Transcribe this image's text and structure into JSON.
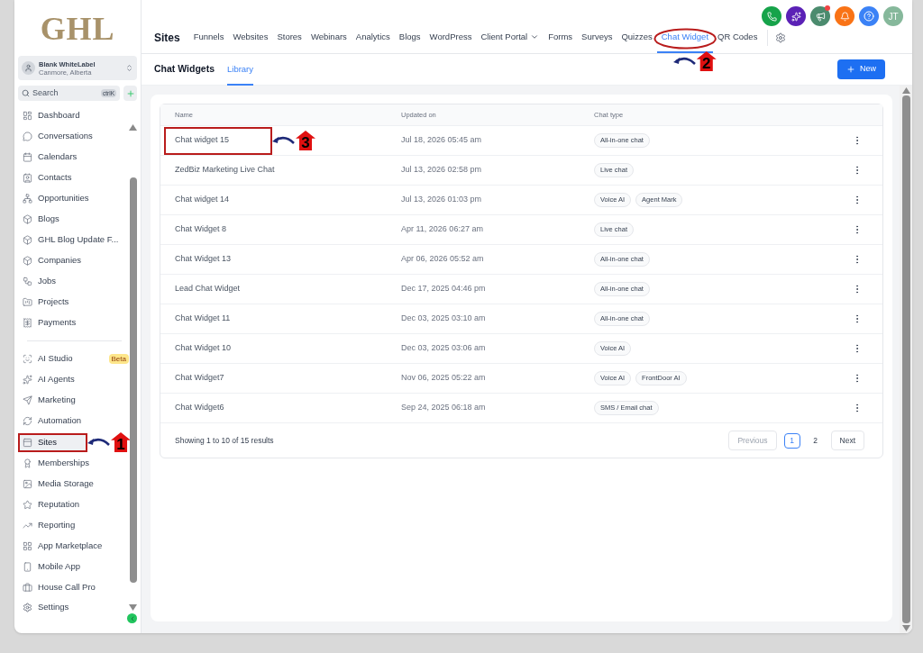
{
  "logo": "GHL",
  "account": {
    "name": "Blank WhiteLabel",
    "location": "Canmore, Alberta"
  },
  "search": {
    "placeholder": "Search",
    "shortcut": "ctrlK"
  },
  "sidebar": {
    "sections": [
      {
        "items": [
          {
            "label": "Dashboard",
            "selected": false
          },
          {
            "label": "Conversations",
            "selected": false
          },
          {
            "label": "Calendars",
            "selected": false
          },
          {
            "label": "Contacts",
            "selected": false
          },
          {
            "label": "Opportunities",
            "selected": false
          },
          {
            "label": "Blogs",
            "selected": false
          },
          {
            "label": "GHL Blog Update F...",
            "selected": false
          },
          {
            "label": "Companies",
            "selected": false
          },
          {
            "label": "Jobs",
            "selected": false
          },
          {
            "label": "Projects",
            "selected": false
          },
          {
            "label": "Payments",
            "selected": false
          }
        ]
      },
      {
        "items": [
          {
            "label": "AI Studio",
            "selected": false,
            "badge": "Beta"
          },
          {
            "label": "AI Agents",
            "selected": false
          },
          {
            "label": "Marketing",
            "selected": false
          },
          {
            "label": "Automation",
            "selected": false
          },
          {
            "label": "Sites",
            "selected": true,
            "annotation": "1"
          },
          {
            "label": "Memberships",
            "selected": false
          },
          {
            "label": "Media Storage",
            "selected": false
          },
          {
            "label": "Reputation",
            "selected": false
          },
          {
            "label": "Reporting",
            "selected": false
          },
          {
            "label": "App Marketplace",
            "selected": false
          },
          {
            "label": "Mobile App",
            "selected": false
          },
          {
            "label": "House Call Pro",
            "selected": false
          }
        ]
      }
    ],
    "footer": {
      "label": "Settings"
    }
  },
  "top_nav": {
    "title": "Sites",
    "tabs": [
      {
        "label": "Funnels",
        "selected": false
      },
      {
        "label": "Websites",
        "selected": false
      },
      {
        "label": "Stores",
        "selected": false
      },
      {
        "label": "Webinars",
        "selected": false
      },
      {
        "label": "Analytics",
        "selected": false
      },
      {
        "label": "Blogs",
        "selected": false
      },
      {
        "label": "WordPress",
        "selected": false
      },
      {
        "label": "Client Portal",
        "selected": false,
        "dropdown": true
      },
      {
        "label": "Forms",
        "selected": false
      },
      {
        "label": "Surveys",
        "selected": false
      },
      {
        "label": "Quizzes",
        "selected": false
      },
      {
        "label": "Chat Widget",
        "selected": true,
        "annotation": "2"
      },
      {
        "label": "QR Codes",
        "selected": false
      }
    ]
  },
  "header_icons": [
    {
      "kind": "phone",
      "color": "#16a34a"
    },
    {
      "kind": "sparkle",
      "color": "#5b21b6"
    },
    {
      "kind": "megaphone",
      "color": "#4b8b6e",
      "dot": true
    },
    {
      "kind": "bell",
      "color": "#f97316"
    },
    {
      "kind": "help",
      "color": "#3b82f6"
    },
    {
      "kind": "avatar",
      "color": "#86b89b",
      "text": "JT"
    }
  ],
  "sub_tabs": {
    "title": "Chat Widgets",
    "tabs": [
      {
        "label": "Library",
        "selected": true
      }
    ]
  },
  "new_button": "New",
  "table": {
    "columns": [
      "Name",
      "Updated on",
      "Chat type"
    ],
    "rows": [
      {
        "name": "Chat widget 15",
        "updated": "Jul 18, 2026 05:45 am",
        "types": [
          "All-in-one chat"
        ],
        "annotation": "3"
      },
      {
        "name": "ZedBiz Marketing Live Chat",
        "updated": "Jul 13, 2026 02:58 pm",
        "types": [
          "Live chat"
        ]
      },
      {
        "name": "Chat widget 14",
        "updated": "Jul 13, 2026 01:03 pm",
        "types": [
          "Voice AI",
          "Agent Mark"
        ]
      },
      {
        "name": "Chat Widget 8",
        "updated": "Apr 11, 2026 06:27 am",
        "types": [
          "Live chat"
        ]
      },
      {
        "name": "Chat Widget 13",
        "updated": "Apr 06, 2026 05:52 am",
        "types": [
          "All-in-one chat"
        ]
      },
      {
        "name": "Lead Chat Widget",
        "updated": "Dec 17, 2025 04:46 pm",
        "types": [
          "All-in-one chat"
        ]
      },
      {
        "name": "Chat Widget 11",
        "updated": "Dec 03, 2025 03:10 am",
        "types": [
          "All-in-one chat"
        ]
      },
      {
        "name": "Chat Widget 10",
        "updated": "Dec 03, 2025 03:06 am",
        "types": [
          "Voice AI"
        ]
      },
      {
        "name": "Chat Widget7",
        "updated": "Nov 06, 2025 05:22 am",
        "types": [
          "Voice AI",
          "FrontDoor AI"
        ]
      },
      {
        "name": "Chat Widget6",
        "updated": "Sep 24, 2025 06:18 am",
        "types": [
          "SMS / Email chat"
        ]
      }
    ],
    "summary": "Showing 1 to 10 of 15 results",
    "pagination": {
      "previous": {
        "label": "Previous",
        "disabled": true
      },
      "pages": [
        {
          "label": "1",
          "selected": true
        },
        {
          "label": "2",
          "selected": false
        }
      ],
      "next": {
        "label": "Next",
        "disabled": false
      }
    }
  }
}
